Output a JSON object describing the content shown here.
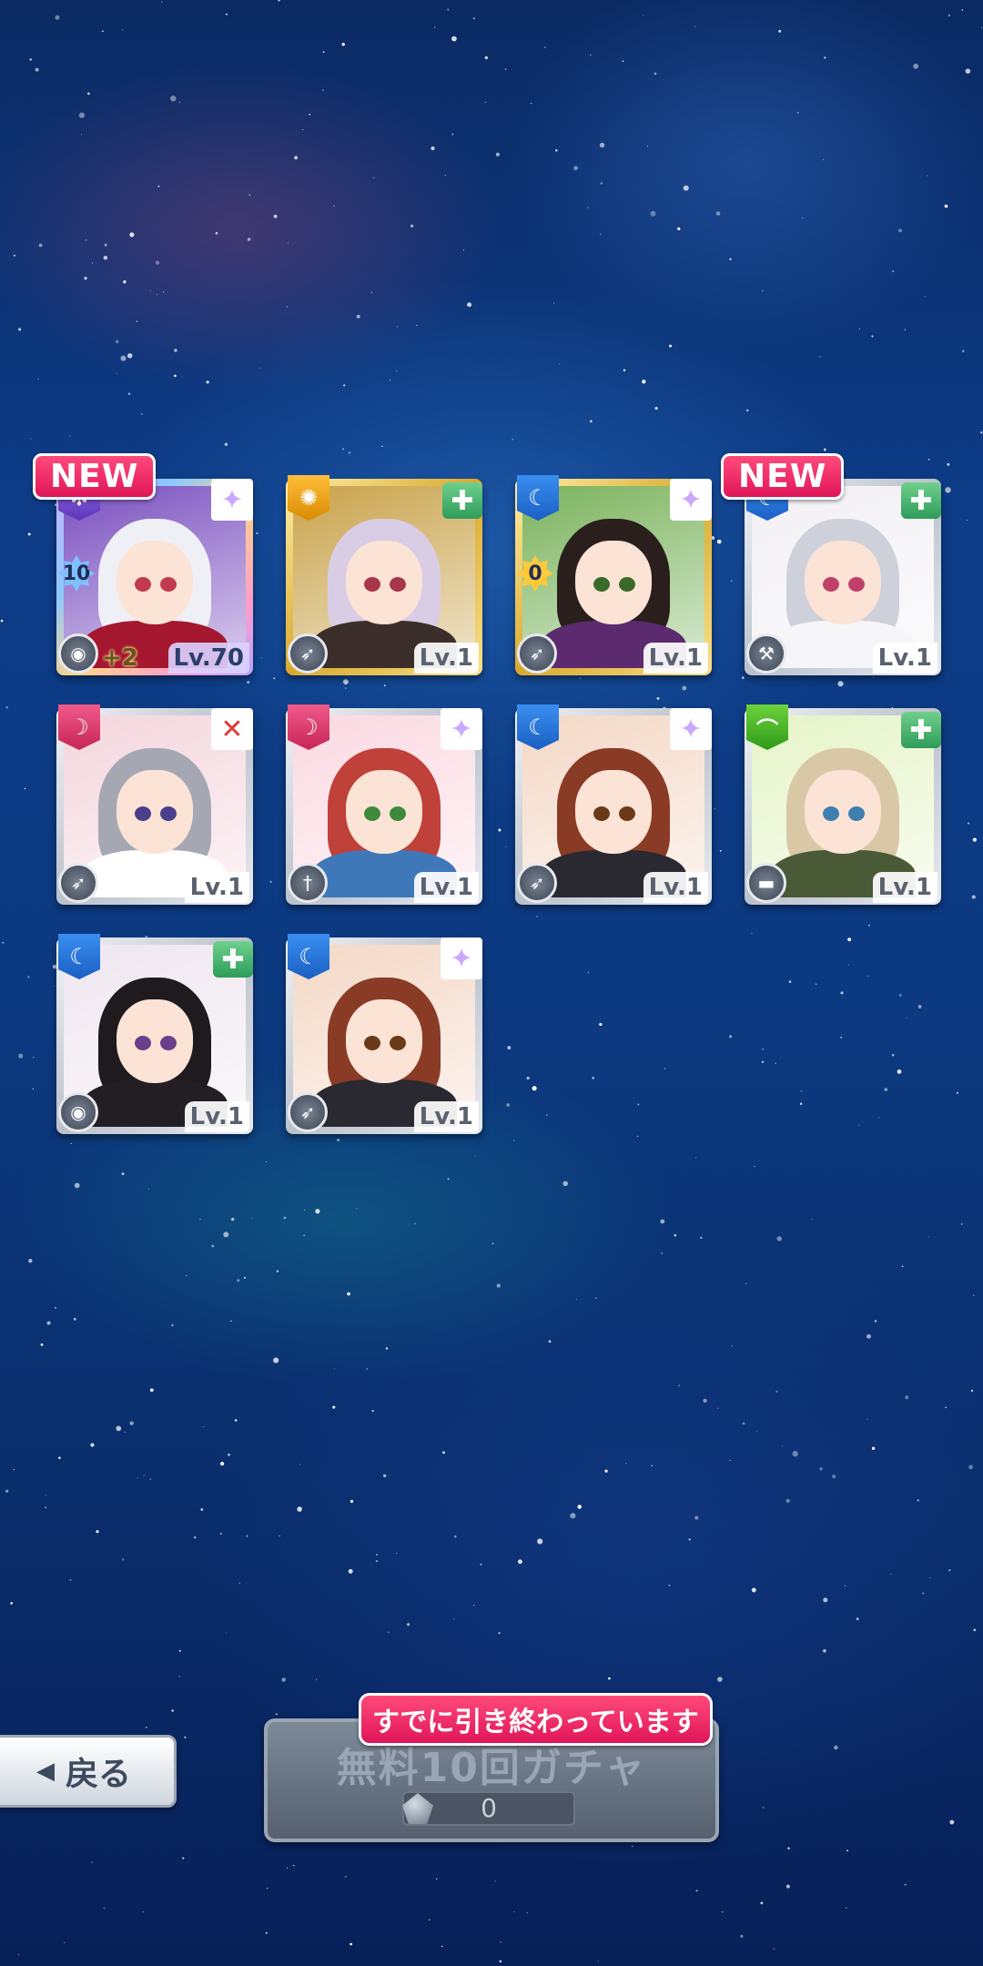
{
  "colors": {
    "new_tag": "#e0165a",
    "frame_silver": "#c4cbd5",
    "frame_gold": "#e3b640",
    "button_disabled": "#6b7684"
  },
  "results": {
    "new_label": "NEW",
    "cards": [
      {
        "new": true,
        "frame": "rainbow",
        "attribute": "purple",
        "role": "star-icon",
        "weapon": "shield-icon",
        "count": "10",
        "count_color": "blue",
        "plus": "+2",
        "level": "Lv.70",
        "hair": "#eef0f6",
        "eyes": "#c23a4e",
        "bg": "#7a4fc0",
        "outfit": "#a5172e"
      },
      {
        "new": false,
        "frame": "gold",
        "attribute": "gold",
        "role": "heal-icon",
        "weapon": "feather-icon",
        "level": "Lv.1",
        "hair": "#d9cde6",
        "eyes": "#a8364a",
        "bg": "#c9a34b",
        "outfit": "#3b2e2a"
      },
      {
        "new": false,
        "frame": "gold",
        "attribute": "blue",
        "role": "star-icon",
        "weapon": "feather-icon",
        "count": "0",
        "count_color": "gold",
        "level": "Lv.1",
        "hair": "#2a1f1c",
        "eyes": "#3a6a2a",
        "bg": "#7ab35c",
        "outfit": "#5c2a6e"
      },
      {
        "new": true,
        "frame": "silver",
        "attribute": "blue",
        "role": "heal-icon",
        "weapon": "hammer-icon",
        "level": "Lv.1",
        "hair": "#cfd1da",
        "eyes": "#c0406a",
        "bg": "#f2f0f4",
        "outfit": "#f6f6f8"
      },
      {
        "new": false,
        "frame": "silver",
        "attribute": "pink",
        "role": "sword-icon",
        "weapon": "feather-icon",
        "level": "Lv.1",
        "hair": "#a5a8b2",
        "eyes": "#4a3f8a",
        "bg": "#f4d6de",
        "outfit": "#ffffff"
      },
      {
        "new": false,
        "frame": "silver",
        "attribute": "pink",
        "role": "star-icon",
        "weapon": "dagger-icon",
        "level": "Lv.1",
        "hair": "#c0403a",
        "eyes": "#3f8a3a",
        "bg": "#fbd9e2",
        "outfit": "#3f78b8"
      },
      {
        "new": false,
        "frame": "silver",
        "attribute": "blue",
        "role": "star-icon",
        "weapon": "feather-icon",
        "level": "Lv.1",
        "hair": "#8a3b26",
        "eyes": "#6a3a18",
        "bg": "#f4d8c6",
        "outfit": "#2a2830"
      },
      {
        "new": false,
        "frame": "silver",
        "attribute": "green",
        "role": "heal-icon",
        "weapon": "gun-icon",
        "level": "Lv.1",
        "hair": "#d9c8a6",
        "eyes": "#3e7fb0",
        "bg": "#e6f4c8",
        "outfit": "#4a5a36"
      },
      {
        "new": false,
        "frame": "silver",
        "attribute": "blue",
        "role": "heal-icon",
        "weapon": "shield-icon",
        "level": "Lv.1",
        "hair": "#1e1a1e",
        "eyes": "#6a3e8a",
        "bg": "#efe6f0",
        "outfit": "#221e24"
      },
      {
        "new": false,
        "frame": "silver",
        "attribute": "blue",
        "role": "star-icon",
        "weapon": "feather-icon",
        "level": "Lv.1",
        "hair": "#8a3b26",
        "eyes": "#6a3a18",
        "bg": "#f4d8c6",
        "outfit": "#2a2830"
      }
    ]
  },
  "controls": {
    "back_label": "戻る",
    "gacha_title": "無料10回ガチャ",
    "gacha_cost": "0",
    "gacha_status": "すでに引き終わっています"
  }
}
